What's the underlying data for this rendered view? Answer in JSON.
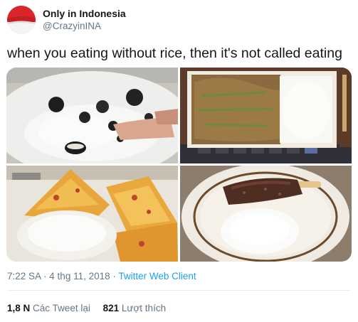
{
  "account": {
    "display_name": "Only in Indonesia",
    "handle": "@CrazyinINA",
    "avatar_icon": "indonesia-flag-avatar"
  },
  "tweet": {
    "text": "when you eating without rice, then it's not called eating",
    "media": [
      {
        "label": "oreo cookies with rice"
      },
      {
        "label": "instant noodles with rice"
      },
      {
        "label": "pizza with rice"
      },
      {
        "label": "chocolate ice cream bar on rice"
      }
    ]
  },
  "meta": {
    "time": "7:22 SA",
    "separator": " · ",
    "date": "4 thg 11, 2018",
    "source": "Twitter Web Client"
  },
  "stats": {
    "retweets_count": "1,8 N",
    "retweets_label": "Các Tweet lại",
    "likes_count": "821",
    "likes_label": "Lượt thích"
  },
  "colors": {
    "link": "#1da1f2",
    "secondary_text": "#657786",
    "primary_text": "#14171a",
    "divider": "#e6ecf0"
  }
}
